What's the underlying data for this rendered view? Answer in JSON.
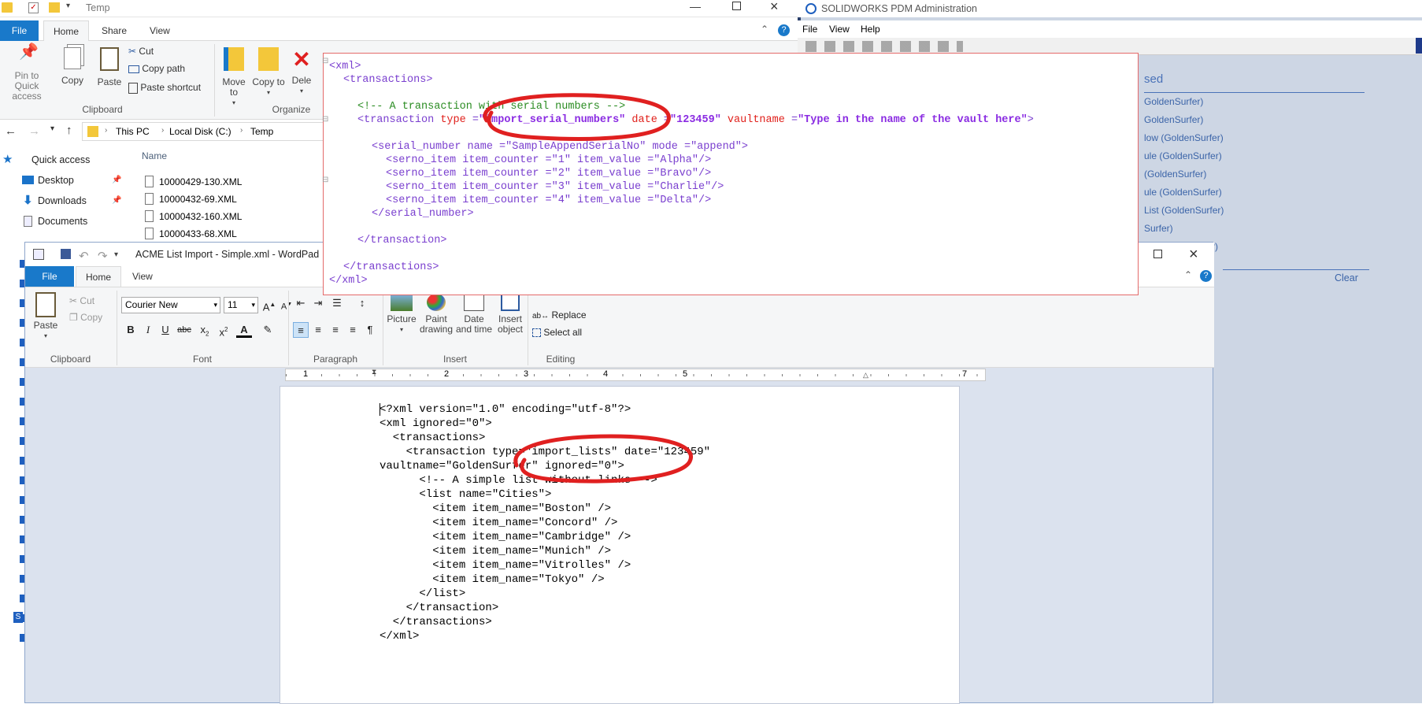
{
  "explorer": {
    "title": "Temp",
    "tabs": {
      "file": "File",
      "home": "Home",
      "share": "Share",
      "view": "View"
    },
    "ribbon": {
      "pin": "Pin to Quick access",
      "copy": "Copy",
      "paste": "Paste",
      "cut": "Cut",
      "copy_path": "Copy path",
      "paste_shortcut": "Paste shortcut",
      "clipboard": "Clipboard",
      "move_to": "Move to",
      "copy_to": "Copy to",
      "delete": "Dele",
      "organize": "Organize"
    },
    "address": {
      "parts": [
        "This PC",
        "Local Disk (C:)",
        "Temp"
      ]
    },
    "nav": {
      "quick_access": "Quick access",
      "desktop": "Desktop",
      "downloads": "Downloads",
      "documents": "Documents"
    },
    "column_name": "Name",
    "files": [
      "10000429-130.XML",
      "10000432-69.XML",
      "10000432-160.XML",
      "10000433-68.XML"
    ]
  },
  "pdm": {
    "title": "SOLIDWORKS PDM Administration",
    "menu": {
      "file": "File",
      "view": "View",
      "help": "Help"
    },
    "history_header": "sed",
    "history": [
      "GoldenSurfer)",
      "GoldenSurfer)",
      "low (GoldenSurfer)",
      "ule (GoldenSurfer)",
      "(GoldenSurfer)",
      "ule (GoldenSurfer)",
      "List (GoldenSurfer)",
      "Surfer)",
      "rt) (GoldenSurfer)"
    ],
    "clear": "Clear"
  },
  "xml_popup": {
    "lines": [
      "<xml>",
      "<transactions>",
      "<!-- A transaction with serial numbers -->",
      "<transaction type =\"import_serial_numbers\" date =\"123459\" vaultname =\"Type in the name of the vault here\">",
      "<serial_number name =\"SampleAppendSerialNo\" mode =\"append\">",
      "<serno_item item_counter =\"1\" item_value =\"Alpha\"/>",
      "<serno_item item_counter =\"2\" item_value =\"Bravo\"/>",
      "<serno_item item_counter =\"3\" item_value =\"Charlie\"/>",
      "<serno_item item_counter =\"4\" item_value =\"Delta\"/>",
      "</serial_number>",
      "</transaction>",
      "</transactions>",
      "</xml>"
    ]
  },
  "wordpad": {
    "title": "ACME List Import - Simple.xml - WordPad",
    "tabs": {
      "file": "File",
      "home": "Home",
      "view": "View"
    },
    "font_name": "Courier New",
    "font_size": "11",
    "labels": {
      "paste": "Paste",
      "cut": "Cut",
      "copy": "Copy",
      "clipboard": "Clipboard",
      "font": "Font",
      "paragraph": "Paragraph",
      "picture": "Picture",
      "paint_drawing": "Paint drawing",
      "date_time": "Date and time",
      "insert_object": "Insert object",
      "insert": "Insert",
      "replace": "Replace",
      "select_all": "Select all",
      "editing": "Editing"
    },
    "ruler": [
      "1",
      "2",
      "3",
      "4",
      "5",
      "7"
    ],
    "document_lines": [
      "<?xml version=\"1.0\" encoding=\"utf-8\"?>",
      "<xml ignored=\"0\">",
      "  <transactions>",
      "    <transaction type=\"import_lists\" date=\"123459\"",
      "vaultname=\"GoldenSurfer\" ignored=\"0\">",
      "      <!-- A simple list without links -->",
      "      <list name=\"Cities\">",
      "        <item item_name=\"Boston\" />",
      "        <item item_name=\"Concord\" />",
      "        <item item_name=\"Cambridge\" />",
      "        <item item_name=\"Munich\" />",
      "        <item item_name=\"Vitrolles\" />",
      "        <item item_name=\"Tokyo\" />",
      "      </list>",
      "    </transaction>",
      "  </transactions>",
      "</xml>"
    ]
  }
}
